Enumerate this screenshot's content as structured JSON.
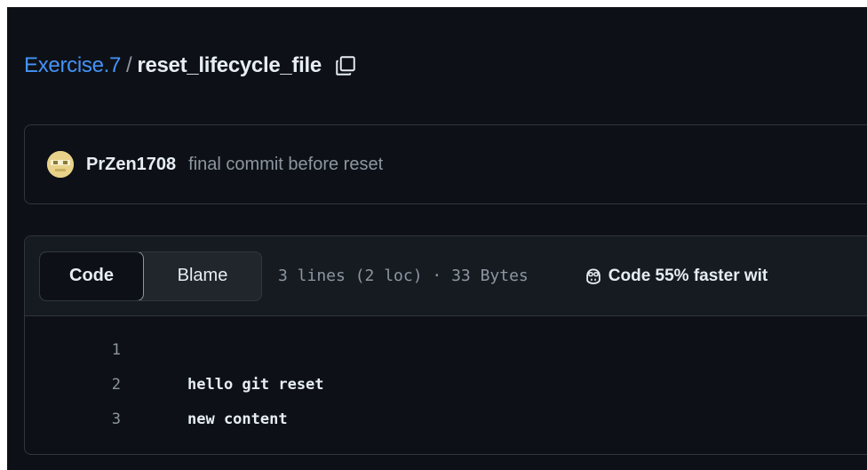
{
  "breadcrumb": {
    "repo": "Exercise.7",
    "separator": "/",
    "file": "reset_lifecycle_file"
  },
  "commit": {
    "author": "PrZen1708",
    "message": "final commit before reset"
  },
  "file_header": {
    "code_tab": "Code",
    "blame_tab": "Blame",
    "active_tab": "Code",
    "info": "3 lines (2 loc) · 33 Bytes",
    "copilot_text": "Code 55% faster wit"
  },
  "code": {
    "lines": [
      {
        "num": "1",
        "text": ""
      },
      {
        "num": "2",
        "text": "hello git reset"
      },
      {
        "num": "3",
        "text": "new content"
      }
    ]
  },
  "icons": {
    "copy": "copy-icon",
    "copilot": "copilot-icon",
    "avatar": "avatar-image"
  },
  "colors": {
    "background": "#0d1117",
    "link": "#4493f8",
    "border": "#30363d",
    "muted": "#8d96a0",
    "text": "#e6edf3"
  }
}
